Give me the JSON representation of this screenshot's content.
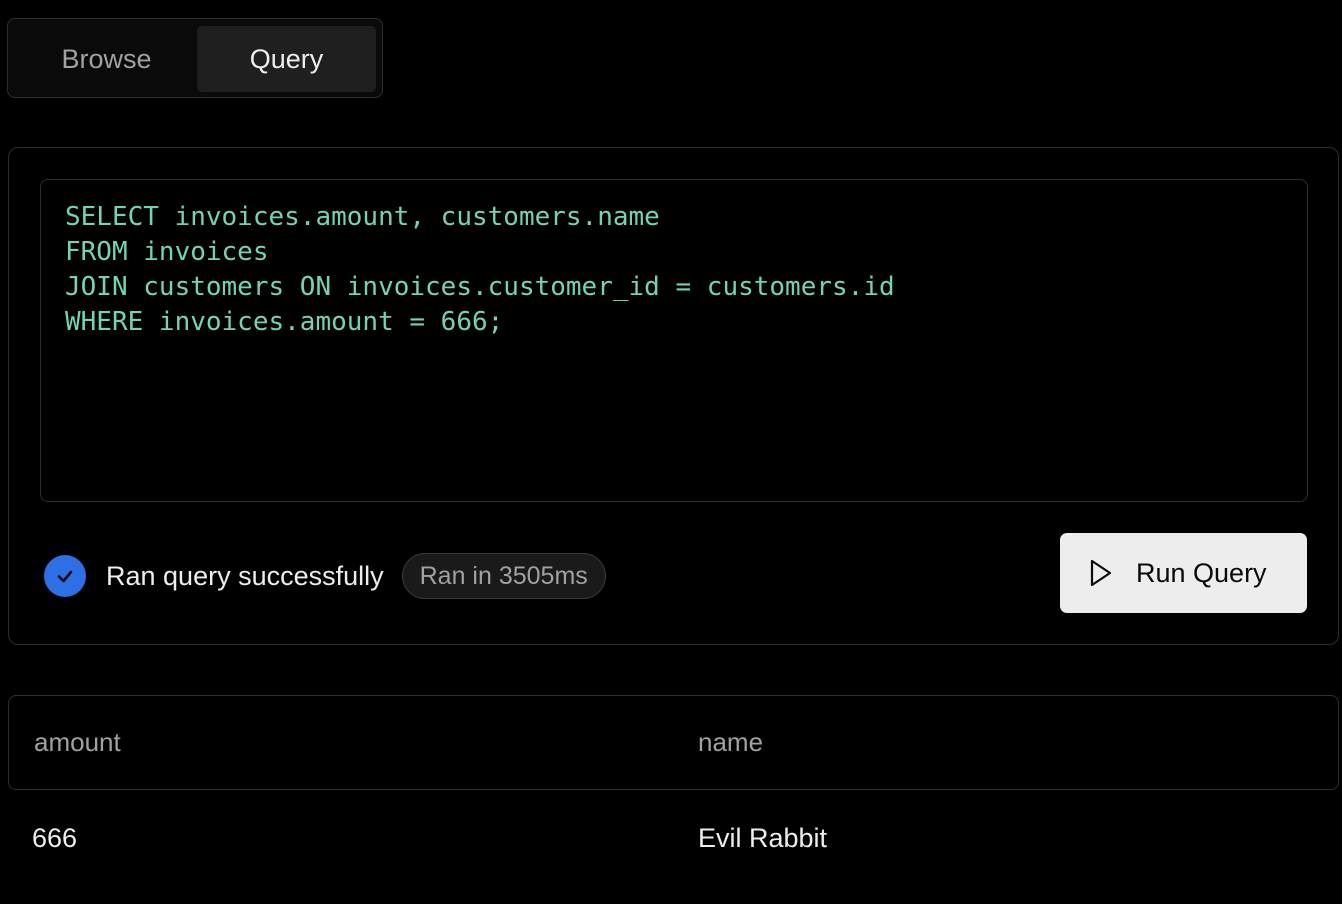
{
  "tabs": [
    {
      "label": "Browse",
      "active": false
    },
    {
      "label": "Query",
      "active": true
    }
  ],
  "editor": {
    "lines": [
      "SELECT invoices.amount, customers.name",
      "FROM invoices",
      "JOIN customers ON invoices.customer_id = customers.id",
      "WHERE invoices.amount = 666;"
    ]
  },
  "status": {
    "icon": "check-icon",
    "text": "Ran query successfully",
    "time_badge": "Ran in 3505ms"
  },
  "run_button": {
    "icon": "play-icon",
    "label": "Run Query"
  },
  "results": {
    "columns": [
      "amount",
      "name"
    ],
    "rows": [
      [
        "666",
        "Evil Rabbit"
      ]
    ]
  },
  "colors": {
    "background": "#000000",
    "code_text": "#74d3b4",
    "success_accent": "#2f6fe6",
    "button_bg": "#ededed"
  }
}
